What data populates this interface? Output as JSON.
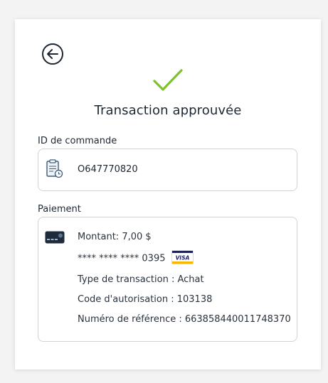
{
  "header": {
    "title": "Transaction approuvée"
  },
  "order": {
    "label": "ID de commande",
    "id": "O647770820"
  },
  "payment": {
    "label": "Paiement",
    "amount": "Montant: 7,00 $",
    "masked_card": "**** **** **** 0395",
    "card_brand": "VISA",
    "transaction_type": "Type de transaction : Achat",
    "auth_code": "Code d'autorisation : 103138",
    "reference": "Numéro de référence : 663858440011748370"
  },
  "colors": {
    "accent_check": "#7dc22b",
    "dark": "#1d2733",
    "border": "#cfd3d7"
  },
  "icons": {
    "back": "arrow-left-circle-icon",
    "success": "checkmark-icon",
    "order": "document-clock-icon",
    "payment": "credit-card-icon",
    "brand": "visa-logo-icon"
  }
}
